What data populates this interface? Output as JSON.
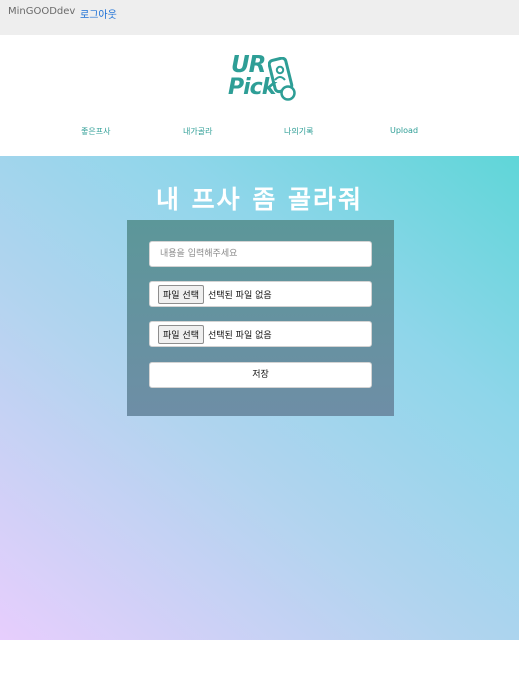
{
  "topbar": {
    "username": "MinGOODdev",
    "logout_label": "로그아웃"
  },
  "logo": {
    "line1": "UR",
    "line2": "Pick",
    "icon": "phone-person-icon",
    "brand_color": "#2e9e96"
  },
  "nav": {
    "items": [
      {
        "label": "좋은프사"
      },
      {
        "label": "내가골라"
      },
      {
        "label": "나의기록"
      },
      {
        "label": "Upload"
      }
    ]
  },
  "hero": {
    "title": "내 프사 좀 골라줘"
  },
  "form": {
    "content_placeholder": "내용을 입력해주세요",
    "file1_button": "파일 선택",
    "file1_status": "선택된 파일 없음",
    "file2_button": "파일 선택",
    "file2_status": "선택된 파일 없음",
    "save_label": "저장"
  }
}
